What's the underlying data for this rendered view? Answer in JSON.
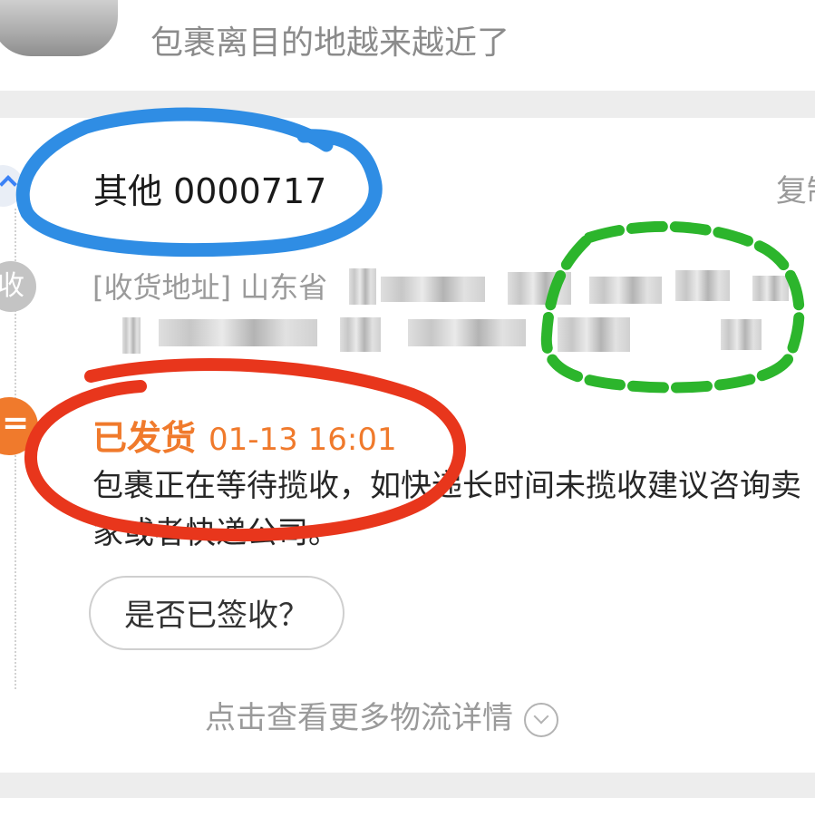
{
  "notice": {
    "text": "包裹离目的地越来越近了"
  },
  "tracking": {
    "number_text": "其他 0000717",
    "copy_label": "复制"
  },
  "address": {
    "icon_char": "收",
    "label": "[收货地址] 山东省"
  },
  "status": {
    "label": "已发货",
    "time": "01-13 16:01",
    "description_line1": "包裹正在等待揽收，如快递长时间未揽收建议咨询卖",
    "description_line2": "家或者快递公司。"
  },
  "signed_button": {
    "label": "是否已签收？"
  },
  "more_link": {
    "label": "点击查看更多物流详情"
  },
  "colors": {
    "status_orange": "#f07a2c",
    "annotation_blue": "#2f8de4",
    "annotation_red": "#e8361c",
    "annotation_green": "#2cb52c"
  },
  "icons": [
    "product-thumbnail",
    "tracking-icon",
    "address-icon",
    "shipping-icon",
    "chevron-down-icon"
  ]
}
